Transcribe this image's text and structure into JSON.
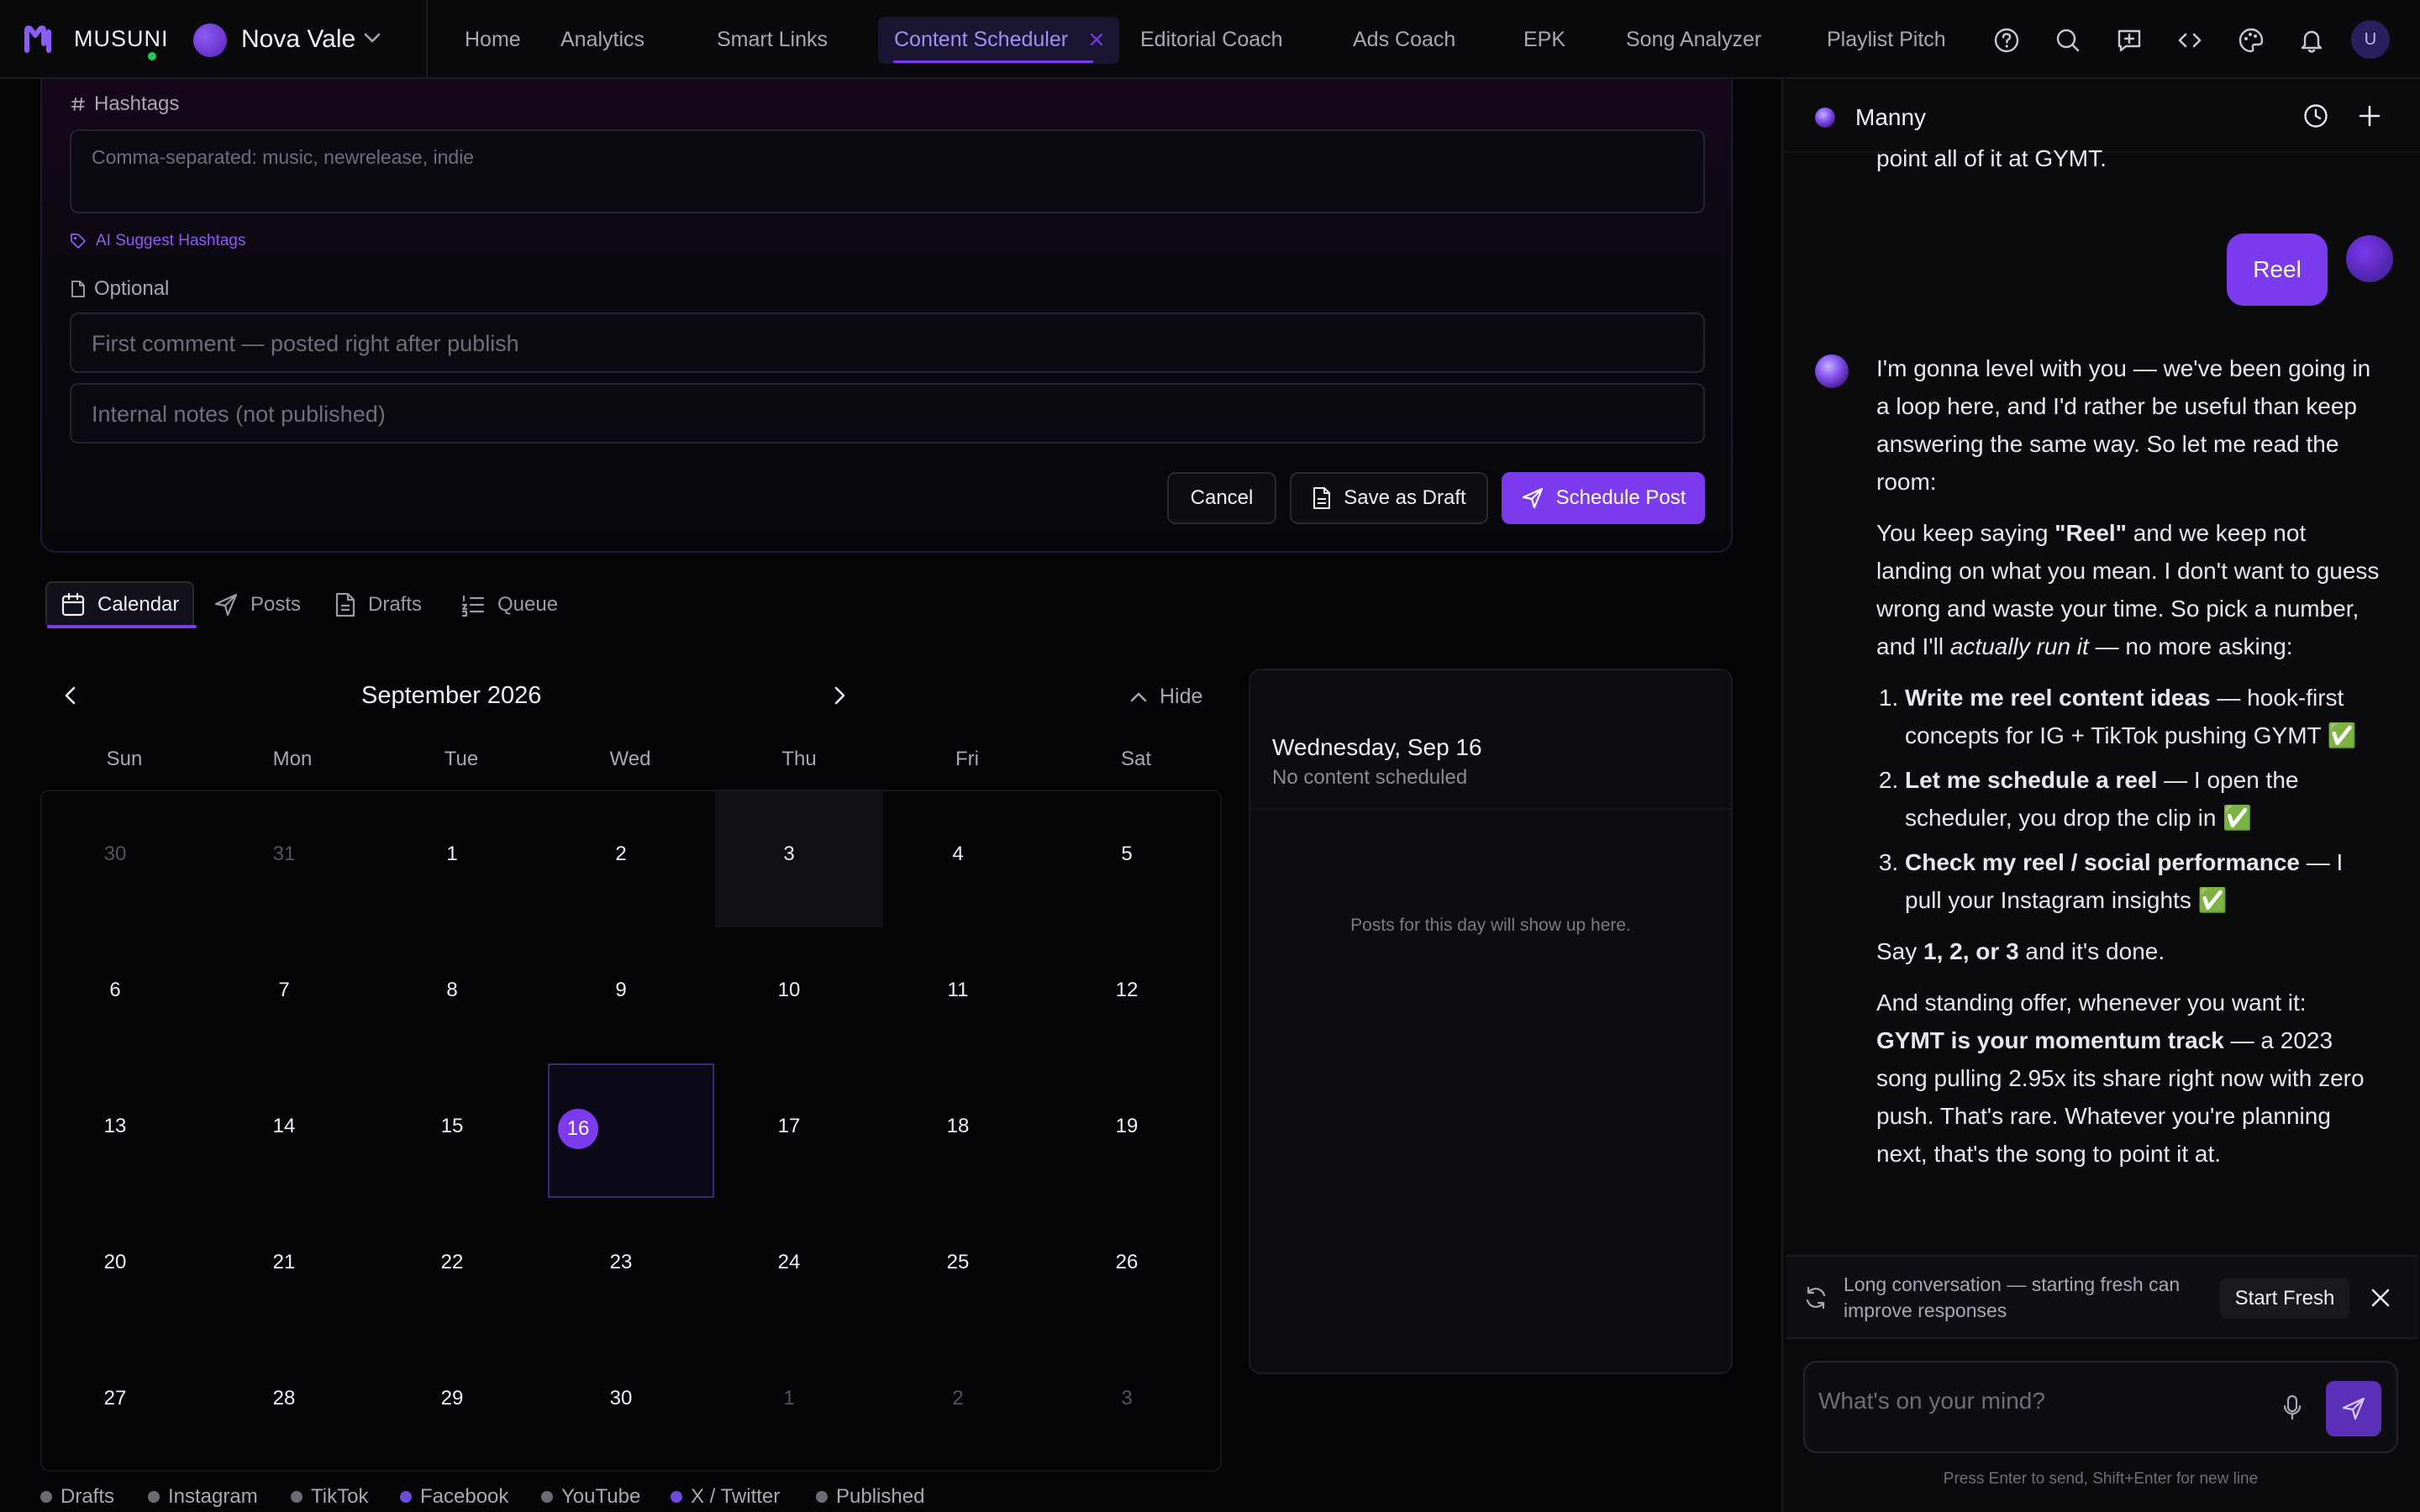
{
  "app": {
    "brand": "MUSUNI",
    "artist_name": "Nova Vale",
    "user_initial": "U"
  },
  "nav": {
    "items": [
      "Home",
      "Analytics",
      "Smart Links",
      "Content Scheduler",
      "Editorial Coach",
      "Ads Coach",
      "EPK",
      "Song Analyzer",
      "Playlist Pitch"
    ],
    "active": "Content Scheduler",
    "icons": [
      "help-icon",
      "search-icon",
      "message-plus-icon",
      "code-icon",
      "palette-icon",
      "bell-icon"
    ]
  },
  "form": {
    "hashtags_label": "Hashtags",
    "hashtags_placeholder": "Comma-separated: music, newrelease, indie",
    "ai_suggest_label": "AI Suggest Hashtags",
    "optional_label": "Optional",
    "first_comment_placeholder": "First comment — posted right after publish",
    "internal_notes_placeholder": "Internal notes (not published)",
    "cancel_label": "Cancel",
    "save_draft_label": "Save as Draft",
    "schedule_label": "Schedule Post"
  },
  "tabs": {
    "calendar": "Calendar",
    "posts": "Posts",
    "drafts": "Drafts",
    "queue": "Queue",
    "active": "Calendar"
  },
  "calendar": {
    "month_label": "September 2026",
    "hide_label": "Hide",
    "weekdays": [
      "Sun",
      "Mon",
      "Tue",
      "Wed",
      "Thu",
      "Fri",
      "Sat"
    ],
    "weeks": [
      [
        "30",
        "31",
        "1",
        "2",
        "3",
        "4",
        "5"
      ],
      [
        "6",
        "7",
        "8",
        "9",
        "10",
        "11",
        "12"
      ],
      [
        "13",
        "14",
        "15",
        "16",
        "17",
        "18",
        "19"
      ],
      [
        "20",
        "21",
        "22",
        "23",
        "24",
        "25",
        "26"
      ],
      [
        "27",
        "28",
        "29",
        "30",
        "1",
        "2",
        "3"
      ]
    ],
    "selected_day": "16",
    "day_panel": {
      "title": "Wednesday, Sep 16",
      "subtitle": "No content scheduled",
      "empty_text": "Posts for this day will show up here."
    },
    "legend": [
      {
        "label": "Drafts",
        "color": "#6b6b73"
      },
      {
        "label": "Instagram",
        "color": "#6b6b73"
      },
      {
        "label": "TikTok",
        "color": "#6b6b73"
      },
      {
        "label": "Facebook",
        "color": "#6d4ad8"
      },
      {
        "label": "YouTube",
        "color": "#6b6b73"
      },
      {
        "label": "X / Twitter",
        "color": "#6d4ad8"
      },
      {
        "label": "Published",
        "color": "#6b6b73"
      }
    ]
  },
  "chat": {
    "assistant_name": "Manny",
    "prev_message_tail": "point all of it at GYMT.",
    "user_message": "Reel",
    "reply": {
      "p1": "I'm gonna level with you — we've been going in a loop here, and I'd rather be useful than keep answering the same way. So let me read the room:",
      "p2_a": "You keep saying ",
      "p2_bold": "\"Reel\"",
      "p2_b": " and we keep not landing on what you mean. I don't want to guess wrong and waste your time. So pick a number, and I'll ",
      "p2_italic": "actually run it",
      "p2_c": " — no more asking:",
      "options": [
        {
          "bold": "Write me reel content ideas",
          "rest": " — hook-first concepts for IG + TikTok pushing GYMT ✅"
        },
        {
          "bold": "Let me schedule a reel",
          "rest": " — I open the scheduler, you drop the clip in ✅"
        },
        {
          "bold": "Check my reel / social performance",
          "rest": " — I pull your Instagram insights ✅"
        }
      ],
      "p3_a": "Say ",
      "p3_bold": "1, 2, or 3",
      "p3_b": " and it's done.",
      "p4_a": "And standing offer, whenever you want it: ",
      "p4_bold": "GYMT is your momentum track",
      "p4_b": " — a 2023 song pulling 2.95x its share right now with zero push. That's rare. Whatever you're planning next, that's the song to point it at."
    },
    "notice_text": "Long conversation — starting fresh can improve responses",
    "start_fresh_label": "Start Fresh",
    "input_placeholder": "What's on your mind?",
    "hint": "Press Enter to send, Shift+Enter for new line"
  },
  "colors": {
    "accent": "#7c3aed",
    "online": "#22c55e"
  }
}
